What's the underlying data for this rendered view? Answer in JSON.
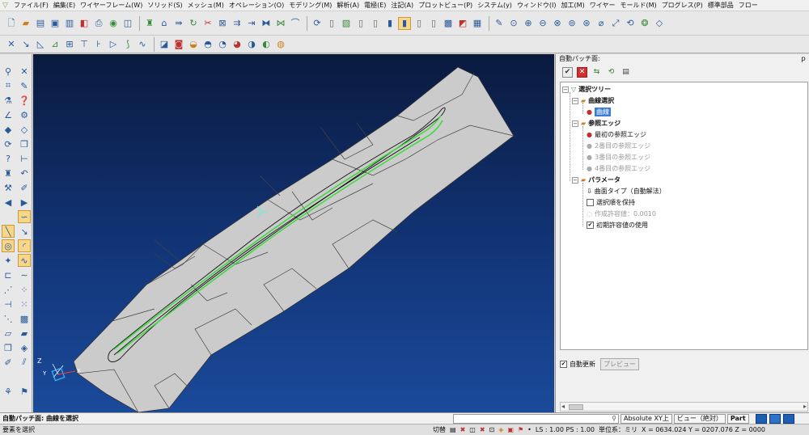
{
  "menu": [
    "ファイル(F)",
    "編集(E)",
    "ワイヤーフレーム(W)",
    "ソリッド(S)",
    "メッシュ(M)",
    "オペレーション(O)",
    "モデリング(M)",
    "解析(A)",
    "電極(E)",
    "注記(A)",
    "プロットビュー(P)",
    "システム(y)",
    "ウィンドウ(I)",
    "加工(M)",
    "ワイヤー",
    "モールド(M)",
    "プログレス(P)",
    "標準部品",
    "フロー"
  ],
  "panel": {
    "title": "自動パッチ面:",
    "pin": "ｐ",
    "tree": {
      "root": "選択ツリー",
      "curve_select": "曲線選択",
      "curve_item": "曲線",
      "ref_edges": "参照エッジ",
      "edge1": "最初の参照エッジ",
      "edge2": "2番目の参照エッジ",
      "edge3": "3番目の参照エッジ",
      "edge4": "4番目の参照エッジ",
      "params": "パラメータ",
      "surface_type": "曲面タイプ（自動解法）",
      "keep_order": "選択順を保持",
      "tolerance": "作成許容値：0.0010",
      "use_initial_tol": "初期許容値の使用"
    },
    "auto_update": "自動更新",
    "preview": "プレビュー"
  },
  "cmdbar": {
    "prompt": "自動パッチ面: 曲線を選択",
    "absolute": "Absolute XY上",
    "view": "ビュー（絶対）",
    "part": "Part"
  },
  "status": {
    "message": "要素を選択",
    "switch": "切替",
    "ls_ps": "LS : 1.00 PS : 1.00",
    "units": "単位系：ミリ",
    "coords": "X = 0634.024 Y = 0207.076 Z = 0000"
  },
  "axes": {
    "x": "X",
    "y": "Y",
    "z": "Z"
  },
  "colors": {
    "viewport_top": "#0a1a3e",
    "viewport_bottom": "#1a4a9a",
    "surface": "#c9c9c9",
    "highlight_curve": "#33dd33",
    "selection": "#3a7bd5"
  }
}
